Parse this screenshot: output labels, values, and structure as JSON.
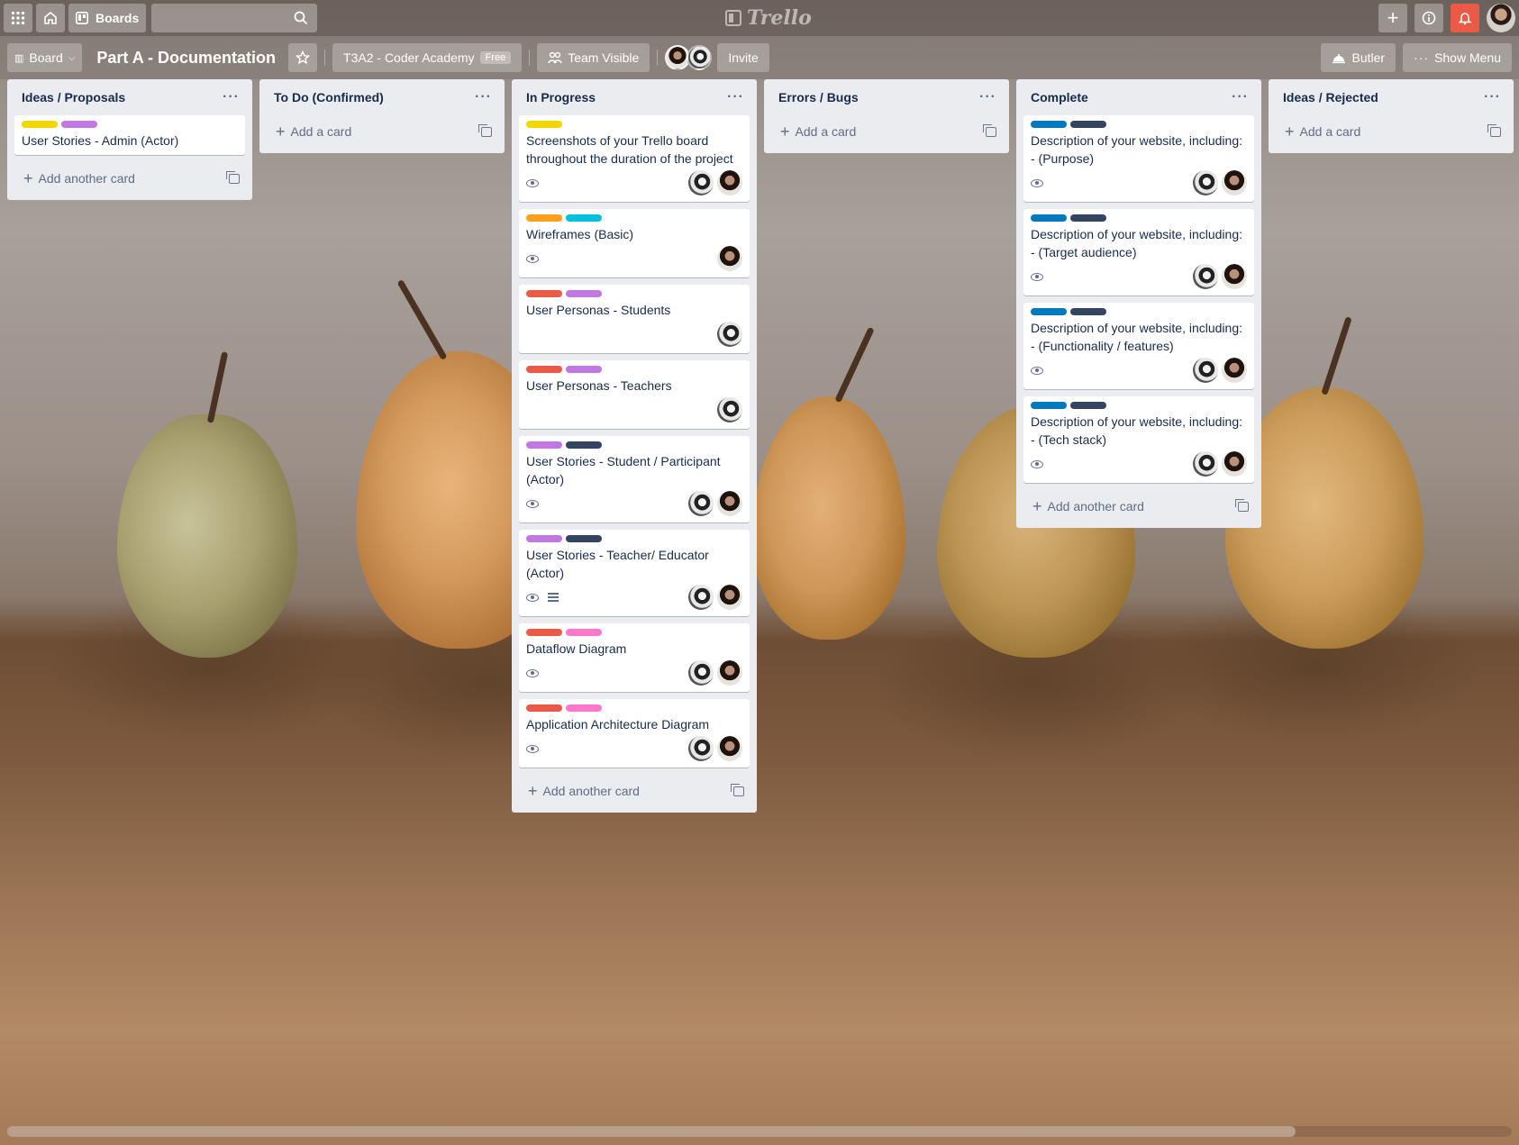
{
  "header": {
    "boards_label": "Boards",
    "logo_text": "Trello"
  },
  "board": {
    "view_label": "Board",
    "title": "Part A - Documentation",
    "team_label": "T3A2 - Coder Academy",
    "team_plan": "Free",
    "visibility_label": "Team Visible",
    "invite_label": "Invite",
    "butler_label": "Butler",
    "show_menu_label": "Show Menu"
  },
  "colors": {
    "yellow": "#f2d600",
    "purple": "#c377e0",
    "orange": "#ff9f1a",
    "sky": "#00c2e0",
    "red": "#eb5a46",
    "navy": "#344563",
    "pink": "#ff78cb",
    "blue": "#0079bf"
  },
  "lists": [
    {
      "title": "Ideas / Proposals",
      "add_label": "Add another card",
      "cards": [
        {
          "title": "User Stories - Admin (Actor)",
          "labels": [
            "yellow",
            "purple"
          ],
          "badges": [],
          "members": []
        }
      ]
    },
    {
      "title": "To Do (Confirmed)",
      "add_label": "Add a card",
      "cards": []
    },
    {
      "title": "In Progress",
      "add_label": "Add another card",
      "cards": [
        {
          "title": "Screenshots of your Trello board throughout the duration of the project",
          "labels": [
            "yellow"
          ],
          "badges": [
            "eye"
          ],
          "members": [
            "b",
            "a"
          ]
        },
        {
          "title": "Wireframes (Basic)",
          "labels": [
            "orange",
            "sky"
          ],
          "badges": [
            "eye"
          ],
          "members": [
            "a"
          ]
        },
        {
          "title": "User Personas - Students",
          "labels": [
            "red",
            "purple"
          ],
          "badges": [],
          "members": [
            "b"
          ]
        },
        {
          "title": "User Personas - Teachers",
          "labels": [
            "red",
            "purple"
          ],
          "badges": [],
          "members": [
            "b"
          ]
        },
        {
          "title": "User Stories - Student / Participant (Actor)",
          "labels": [
            "purple",
            "navy"
          ],
          "badges": [
            "eye"
          ],
          "members": [
            "b",
            "a"
          ]
        },
        {
          "title": "User Stories - Teacher/ Educator (Actor)",
          "labels": [
            "purple",
            "navy"
          ],
          "badges": [
            "eye",
            "desc"
          ],
          "members": [
            "b",
            "a"
          ]
        },
        {
          "title": "Dataflow Diagram",
          "labels": [
            "red",
            "pink"
          ],
          "badges": [
            "eye"
          ],
          "members": [
            "b",
            "a"
          ]
        },
        {
          "title": "Application Architecture Diagram",
          "labels": [
            "red",
            "pink"
          ],
          "badges": [
            "eye"
          ],
          "members": [
            "b",
            "a"
          ]
        }
      ]
    },
    {
      "title": "Errors / Bugs",
      "add_label": "Add a card",
      "cards": []
    },
    {
      "title": "Complete",
      "add_label": "Add another card",
      "cards": [
        {
          "title": "Description of your website, including: - (Purpose)",
          "labels": [
            "blue",
            "navy"
          ],
          "badges": [
            "eye"
          ],
          "members": [
            "b",
            "a"
          ]
        },
        {
          "title": "Description of your website, including: - (Target audience)",
          "labels": [
            "blue",
            "navy"
          ],
          "badges": [
            "eye"
          ],
          "members": [
            "b",
            "a"
          ]
        },
        {
          "title": "Description of your website, including: - (Functionality / features)",
          "labels": [
            "blue",
            "navy"
          ],
          "badges": [
            "eye"
          ],
          "members": [
            "b",
            "a"
          ]
        },
        {
          "title": "Description of your website, including: - (Tech stack)",
          "labels": [
            "blue",
            "navy"
          ],
          "badges": [
            "eye"
          ],
          "members": [
            "b",
            "a"
          ]
        }
      ]
    },
    {
      "title": "Ideas / Rejected",
      "add_label": "Add a card",
      "cards": []
    }
  ]
}
